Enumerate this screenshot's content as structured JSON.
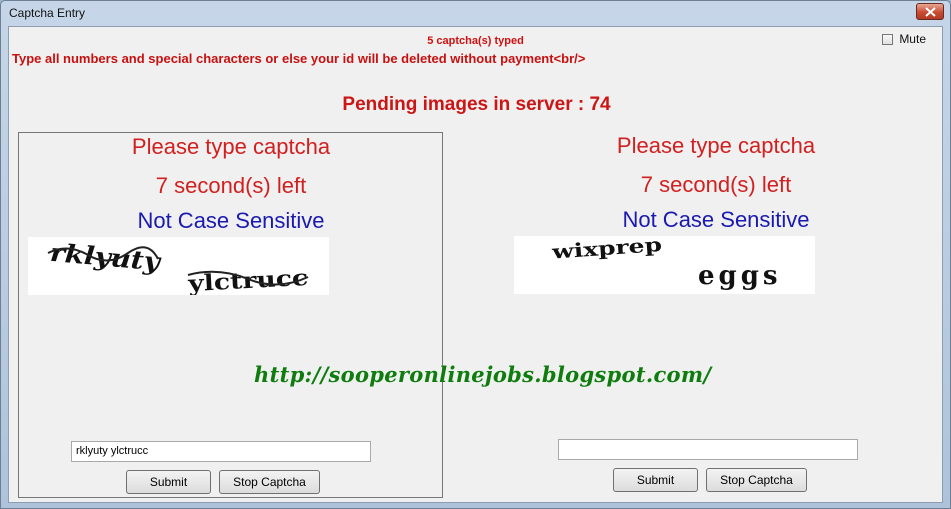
{
  "window": {
    "title": "Captcha Entry"
  },
  "header": {
    "typed_count": "5 captcha(s) typed",
    "warning": "Type all numbers and special characters or else your id will be deleted without payment<br/>",
    "mute_label": "Mute",
    "pending": "Pending images in server : 74"
  },
  "panels": [
    {
      "prompt": "Please type captcha",
      "timer": "7 second(s) left",
      "case_note": "Not Case Sensitive",
      "captcha_words": [
        "rklyuty",
        "ylctrucc"
      ],
      "input_value": "rklyuty ylctrucc",
      "submit_label": "Submit",
      "stop_label": "Stop Captcha"
    },
    {
      "prompt": "Please type captcha",
      "timer": "7 second(s) left",
      "case_note": "Not Case Sensitive",
      "captcha_words": [
        "wixprep",
        "eggs"
      ],
      "input_value": "",
      "submit_label": "Submit",
      "stop_label": "Stop Captcha"
    }
  ],
  "watermark": "http://sooperonlinejobs.blogspot.com/"
}
